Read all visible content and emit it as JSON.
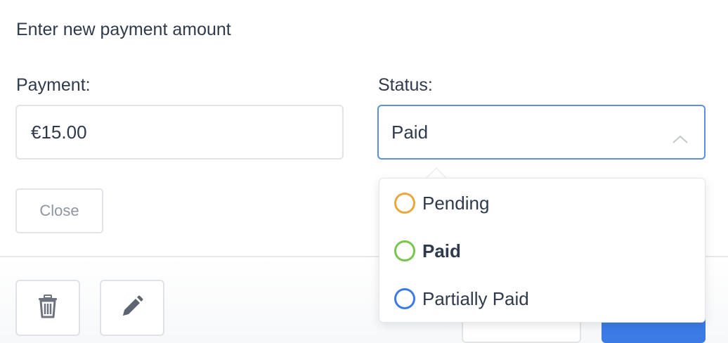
{
  "form": {
    "heading": "Enter new payment amount",
    "payment_label": "Payment:",
    "payment_value": "€15.00",
    "status_label": "Status:",
    "status_value": "Paid",
    "close_label": "Close"
  },
  "dropdown": {
    "options": [
      {
        "label": "Pending",
        "color": "#eba83a"
      },
      {
        "label": "Paid",
        "color": "#78c64b"
      },
      {
        "label": "Partially Paid",
        "color": "#3d7ae6"
      }
    ],
    "selected": "Paid"
  },
  "footer": {
    "icons": [
      "trash-icon",
      "pencil-icon"
    ],
    "primary_color": "#3a7be6"
  }
}
